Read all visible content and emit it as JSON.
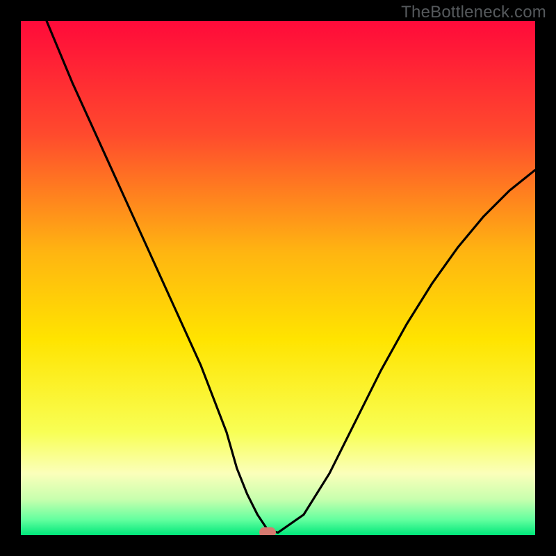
{
  "watermark": "TheBottleneck.com",
  "chart_data": {
    "type": "line",
    "title": "",
    "xlabel": "",
    "ylabel": "",
    "xlim": [
      0,
      100
    ],
    "ylim": [
      0,
      100
    ],
    "grid": false,
    "legend": false,
    "gradient_stops": [
      {
        "offset": 0.0,
        "color": "#ff0a3a"
      },
      {
        "offset": 0.22,
        "color": "#ff4a2d"
      },
      {
        "offset": 0.45,
        "color": "#ffb511"
      },
      {
        "offset": 0.62,
        "color": "#ffe400"
      },
      {
        "offset": 0.8,
        "color": "#f8ff55"
      },
      {
        "offset": 0.88,
        "color": "#fbffba"
      },
      {
        "offset": 0.93,
        "color": "#c8ffae"
      },
      {
        "offset": 0.97,
        "color": "#63ff9f"
      },
      {
        "offset": 1.0,
        "color": "#00e77a"
      }
    ],
    "series": [
      {
        "name": "bottleneck-curve",
        "x": [
          5,
          10,
          15,
          20,
          25,
          30,
          35,
          40,
          42,
          44,
          46,
          48,
          50,
          55,
          60,
          65,
          70,
          75,
          80,
          85,
          90,
          95,
          100
        ],
        "y": [
          100,
          88,
          77,
          66,
          55,
          44,
          33,
          20,
          13,
          8,
          4,
          1,
          0.5,
          4,
          12,
          22,
          32,
          41,
          49,
          56,
          62,
          67,
          71
        ]
      }
    ],
    "marker": {
      "x": 48,
      "y": 0.5,
      "color": "#d67a70"
    }
  }
}
